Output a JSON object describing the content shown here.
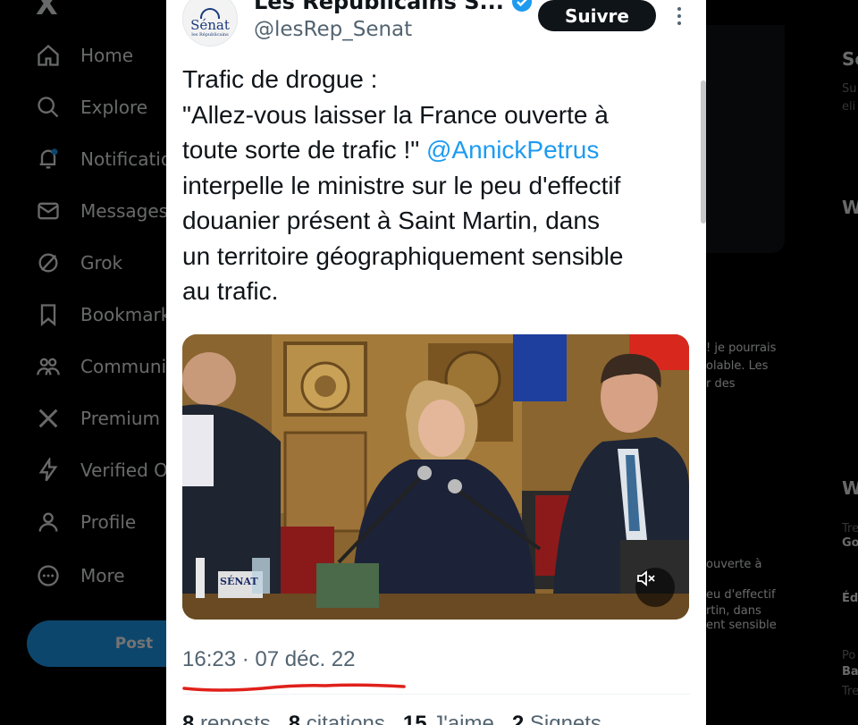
{
  "sidebar": {
    "logo": "X",
    "items": [
      {
        "label": "Home",
        "icon": "home-icon"
      },
      {
        "label": "Explore",
        "icon": "search-icon"
      },
      {
        "label": "Notifications",
        "icon": "bell-icon"
      },
      {
        "label": "Messages",
        "icon": "mail-icon"
      },
      {
        "label": "Grok",
        "icon": "grok-icon"
      },
      {
        "label": "Bookmarks",
        "icon": "bookmark-icon"
      },
      {
        "label": "Communities",
        "icon": "communities-icon"
      },
      {
        "label": "Premium",
        "icon": "x-icon"
      },
      {
        "label": "Verified Orgs",
        "icon": "lightning-icon"
      },
      {
        "label": "Profile",
        "icon": "person-icon"
      },
      {
        "label": "More",
        "icon": "more-circle-icon"
      }
    ],
    "post_label": "Post"
  },
  "tweet": {
    "account_name": "Les Républicains S...",
    "handle": "@lesRep_Senat",
    "follow_label": "Suivre",
    "avatar_text": "Sénat",
    "avatar_subtext": "les Républicains",
    "text_line1": "Trafic de drogue :",
    "text_line2": "\"Allez-vous laisser la France ouverte à",
    "text_line3a": "toute sorte de trafic !\" ",
    "mention": "@AnnickPetrus",
    "text_line4": "interpelle le ministre sur le peu d'effectif",
    "text_line5": "douanier présent à Saint Martin, dans",
    "text_line6": "un territoire géographiquement sensible",
    "text_line7": "au trafic.",
    "media_desk_label": "SÉNAT",
    "timestamp": "16:23 · 07 déc. 22",
    "stats": {
      "reposts_count": "8",
      "reposts_label": "reposts",
      "quotes_count": "8",
      "quotes_label": "citations",
      "likes_count": "15",
      "likes_label": "J'aime",
      "bookmarks_count": "2",
      "bookmarks_label": "Signets"
    }
  },
  "right": {
    "head1": "Se",
    "t1": "Su",
    "t2": "eli",
    "head2": "W",
    "r1": "! je pourrais",
    "r2": "olable. Les",
    "r3": "r des",
    "head3": "W",
    "r4": "Tre",
    "r5": "Go",
    "r6": "ouverte à",
    "r7": "eu d'effectif",
    "r8": "rtin, dans",
    "r9": "ent sensible",
    "r10": "Éd",
    "r11": "Po",
    "r12": "Ba",
    "r13": "Tre"
  },
  "colors": {
    "accent": "#1d9bf0",
    "underline": "#e0201a"
  }
}
